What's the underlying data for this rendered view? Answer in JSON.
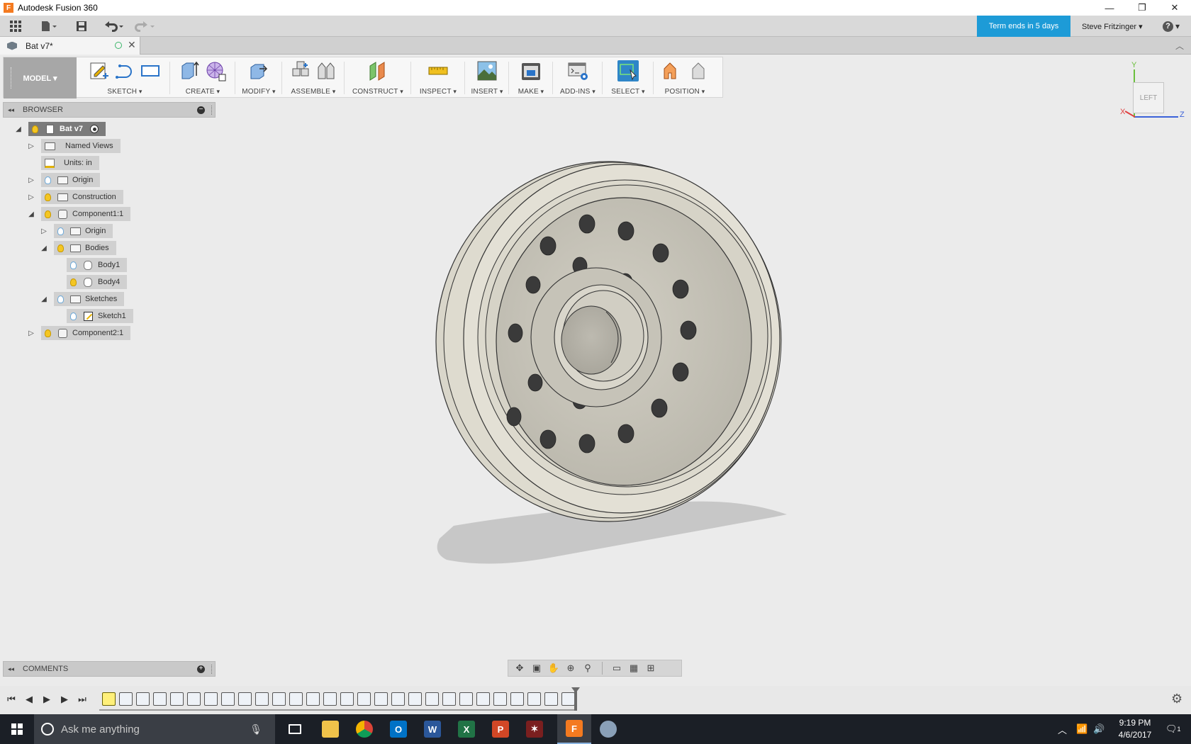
{
  "window": {
    "title": "Autodesk Fusion 360",
    "app_icon": "F",
    "controls": [
      "—",
      "❐",
      "✕"
    ]
  },
  "appbar": {
    "term_notice": "Term ends in 5 days",
    "user": "Steve Fritzinger ▾",
    "help": "▾"
  },
  "document": {
    "tab_name": "Bat v7*"
  },
  "toolbar": {
    "workspace": "MODEL ▾",
    "groups": [
      "SKETCH",
      "CREATE",
      "MODIFY",
      "ASSEMBLE",
      "CONSTRUCT",
      "INSPECT",
      "INSERT",
      "MAKE",
      "ADD-INS",
      "SELECT",
      "POSITION"
    ]
  },
  "browser": {
    "title": "BROWSER",
    "collapse": "◂◂",
    "minus": "−",
    "nodes": [
      {
        "label": "Bat v7"
      },
      {
        "label": "Named Views"
      },
      {
        "label": "Units: in"
      },
      {
        "label": "Origin"
      },
      {
        "label": "Construction"
      },
      {
        "label": "Component1:1"
      },
      {
        "label": "Origin"
      },
      {
        "label": "Bodies"
      },
      {
        "label": "Body1"
      },
      {
        "label": "Body4"
      },
      {
        "label": "Sketches"
      },
      {
        "label": "Sketch1"
      },
      {
        "label": "Component2:1"
      }
    ]
  },
  "viewcube": {
    "face": "LEFT",
    "y": "Y",
    "z": "Z",
    "x": "X"
  },
  "comments": {
    "title": "COMMENTS",
    "add": "+"
  },
  "taskbar": {
    "search_placeholder": "Ask me anything",
    "time": "9:19 PM",
    "date": "4/6/2017",
    "notification_count": "1"
  },
  "colors": {
    "term_notice": "#1d9bd7",
    "workspace": "#a7a7a7",
    "wheel": "#d9d6ca",
    "bulb_on": "#f4c623"
  }
}
